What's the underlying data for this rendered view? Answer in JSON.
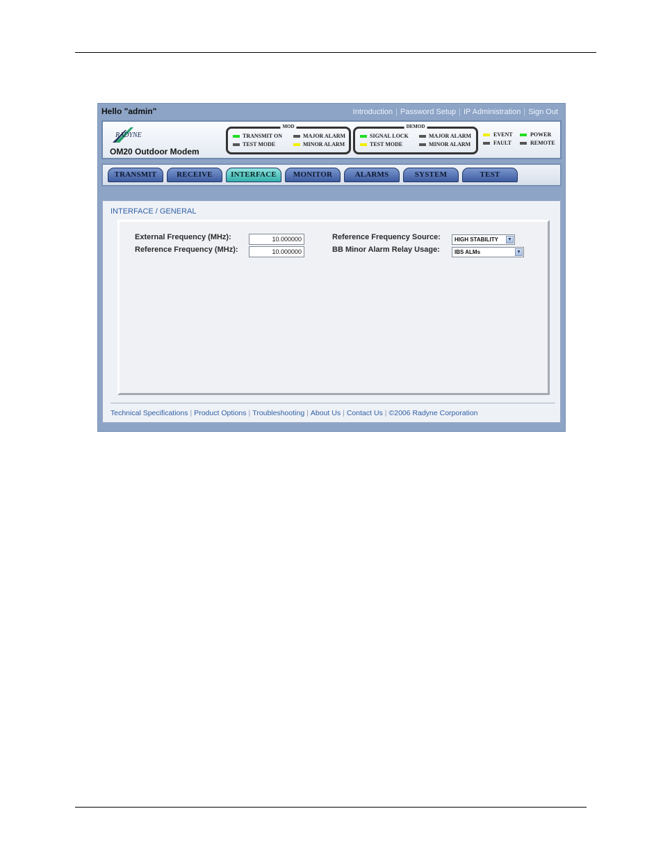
{
  "header": {
    "greeting": "Hello \"admin\"",
    "links": [
      "Introduction",
      "Password Setup",
      "IP Administration",
      "Sign Out"
    ]
  },
  "brand": {
    "logo_text": "RADYNE",
    "model": "OM20 Outdoor Modem"
  },
  "status": {
    "mod": {
      "title": "MOD",
      "leds": [
        {
          "label": "TRANSMIT ON",
          "color": "#22dd22"
        },
        {
          "label": "TEST MODE",
          "color": "#555555"
        },
        {
          "label": "MAJOR ALARM",
          "color": "#555555"
        },
        {
          "label": "MINOR ALARM",
          "color": "#f2ee00"
        }
      ]
    },
    "demod": {
      "title": "DEMOD",
      "leds": [
        {
          "label": "SIGNAL LOCK",
          "color": "#22dd22"
        },
        {
          "label": "TEST MODE",
          "color": "#f2ee00"
        },
        {
          "label": "MAJOR ALARM",
          "color": "#555555"
        },
        {
          "label": "MINOR ALARM",
          "color": "#555555"
        }
      ]
    },
    "other": [
      {
        "label": "EVENT",
        "color": "#f2ee00"
      },
      {
        "label": "FAULT",
        "color": "#555555"
      },
      {
        "label": "POWER",
        "color": "#22dd22"
      },
      {
        "label": "REMOTE",
        "color": "#555555"
      }
    ]
  },
  "tabs": [
    "TRANSMIT",
    "RECEIVE",
    "INTERFACE",
    "MONITOR",
    "ALARMS",
    "SYSTEM",
    "TEST"
  ],
  "active_tab": "INTERFACE",
  "breadcrumb": "INTERFACE / GENERAL",
  "form": {
    "external_frequency": {
      "label": "External Frequency (MHz):",
      "value": "10.000000"
    },
    "reference_frequency": {
      "label": "Reference Frequency (MHz):",
      "value": "10.000000"
    },
    "reference_source": {
      "label": "Reference Frequency Source:",
      "value": "HIGH STABILITY"
    },
    "bb_minor_alarm": {
      "label": "BB Minor Alarm Relay Usage:",
      "value": "IBS ALMs"
    }
  },
  "footer": {
    "links": [
      "Technical Specifications",
      "Product Options",
      "Troubleshooting",
      "About Us",
      "Contact Us"
    ],
    "copyright": "©2006 Radyne Corporation"
  },
  "colors": {
    "frame": "#8da4c6",
    "tab": "#3e5ca0",
    "tab_active": "#33b0ab",
    "link": "#2f5fa5"
  }
}
